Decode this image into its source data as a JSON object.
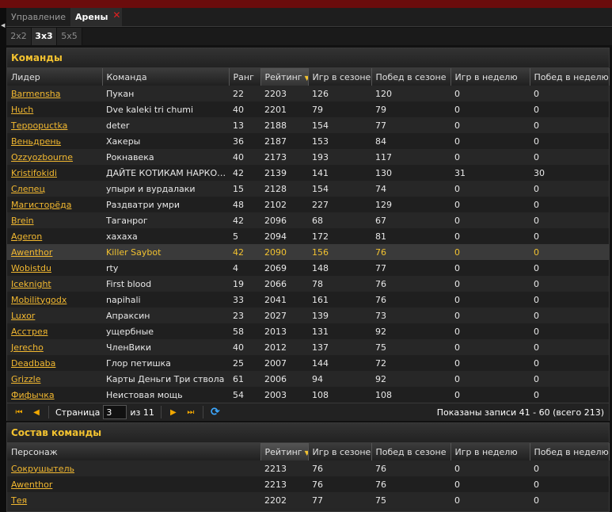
{
  "tabs": [
    {
      "label": "Управление"
    },
    {
      "label": "Арены"
    }
  ],
  "subtabs": [
    {
      "label": "2x2"
    },
    {
      "label": "3x3"
    },
    {
      "label": "5x5"
    }
  ],
  "teams": {
    "title": "Команды",
    "columns": [
      "Лидер",
      "Команда",
      "Ранг",
      "Рейтинг",
      "Игр в сезоне",
      "Побед в сезоне",
      "Игр в неделю",
      "Побед в неделю"
    ],
    "rows": [
      [
        "Barmensha",
        "Пукан",
        "22",
        "2203",
        "126",
        "120",
        "0",
        "0"
      ],
      [
        "Huch",
        "Dve kaleki tri chumi",
        "40",
        "2201",
        "79",
        "79",
        "0",
        "0"
      ],
      [
        "Терpopuctka",
        "deter",
        "13",
        "2188",
        "154",
        "77",
        "0",
        "0"
      ],
      [
        "Веньдрень",
        "Хакеры",
        "36",
        "2187",
        "153",
        "84",
        "0",
        "0"
      ],
      [
        "Ozzyozbourne",
        "Рокнавека",
        "40",
        "2173",
        "193",
        "117",
        "0",
        "0"
      ],
      [
        "Kristifokidi",
        "ДАЙТЕ КОТИКАМ НАРКОТИКИ",
        "42",
        "2139",
        "141",
        "130",
        "31",
        "30"
      ],
      [
        "Слепец",
        "упыри и вурдалаки",
        "15",
        "2128",
        "154",
        "74",
        "0",
        "0"
      ],
      [
        "Магисторёда",
        "Раздватри умри",
        "48",
        "2102",
        "227",
        "129",
        "0",
        "0"
      ],
      [
        "Brein",
        "Таганрог",
        "42",
        "2096",
        "68",
        "67",
        "0",
        "0"
      ],
      [
        "Ageron",
        "хахаха",
        "5",
        "2094",
        "172",
        "81",
        "0",
        "0"
      ],
      [
        "Awenthor",
        "Killer Saybot",
        "42",
        "2090",
        "156",
        "76",
        "0",
        "0"
      ],
      [
        "Wobistdu",
        "rty",
        "4",
        "2069",
        "148",
        "77",
        "0",
        "0"
      ],
      [
        "Iceknight",
        "First blood",
        "19",
        "2066",
        "78",
        "76",
        "0",
        "0"
      ],
      [
        "Mobilitygodx",
        "napihali",
        "33",
        "2041",
        "161",
        "76",
        "0",
        "0"
      ],
      [
        "Luxor",
        "Апраксин",
        "23",
        "2027",
        "139",
        "73",
        "0",
        "0"
      ],
      [
        "Асстрея",
        "ущербные",
        "58",
        "2013",
        "131",
        "92",
        "0",
        "0"
      ],
      [
        "Jerecho",
        "ЧленВики",
        "40",
        "2012",
        "137",
        "75",
        "0",
        "0"
      ],
      [
        "Deadbaba",
        "Глор петишка",
        "25",
        "2007",
        "144",
        "72",
        "0",
        "0"
      ],
      [
        "Grizzle",
        "Карты Деньги Три ствола",
        "61",
        "2006",
        "94",
        "92",
        "0",
        "0"
      ],
      [
        "Фифычка",
        "Неистовая мощь",
        "54",
        "2003",
        "108",
        "108",
        "0",
        "0"
      ]
    ],
    "highlight_row": 10
  },
  "pager": {
    "page_label": "Страница",
    "page_value": "3",
    "of_label": "из 11",
    "info": "Показаны записи 41 - 60 (всего 213)"
  },
  "roster": {
    "title": "Состав команды",
    "columns": [
      "Персонаж",
      "Рейтинг",
      "Игр в сезоне",
      "Побед в сезоне",
      "Игр в неделю",
      "Побед в неделю"
    ],
    "rows": [
      [
        "Сокрушытель",
        "2213",
        "76",
        "76",
        "0",
        "0"
      ],
      [
        "Awenthor",
        "2213",
        "76",
        "76",
        "0",
        "0"
      ],
      [
        "Тея",
        "2202",
        "77",
        "75",
        "0",
        "0"
      ]
    ]
  },
  "colors": {
    "accent": "#f2c230",
    "link": "#f2b830",
    "topbar": "#6b0c0c"
  }
}
